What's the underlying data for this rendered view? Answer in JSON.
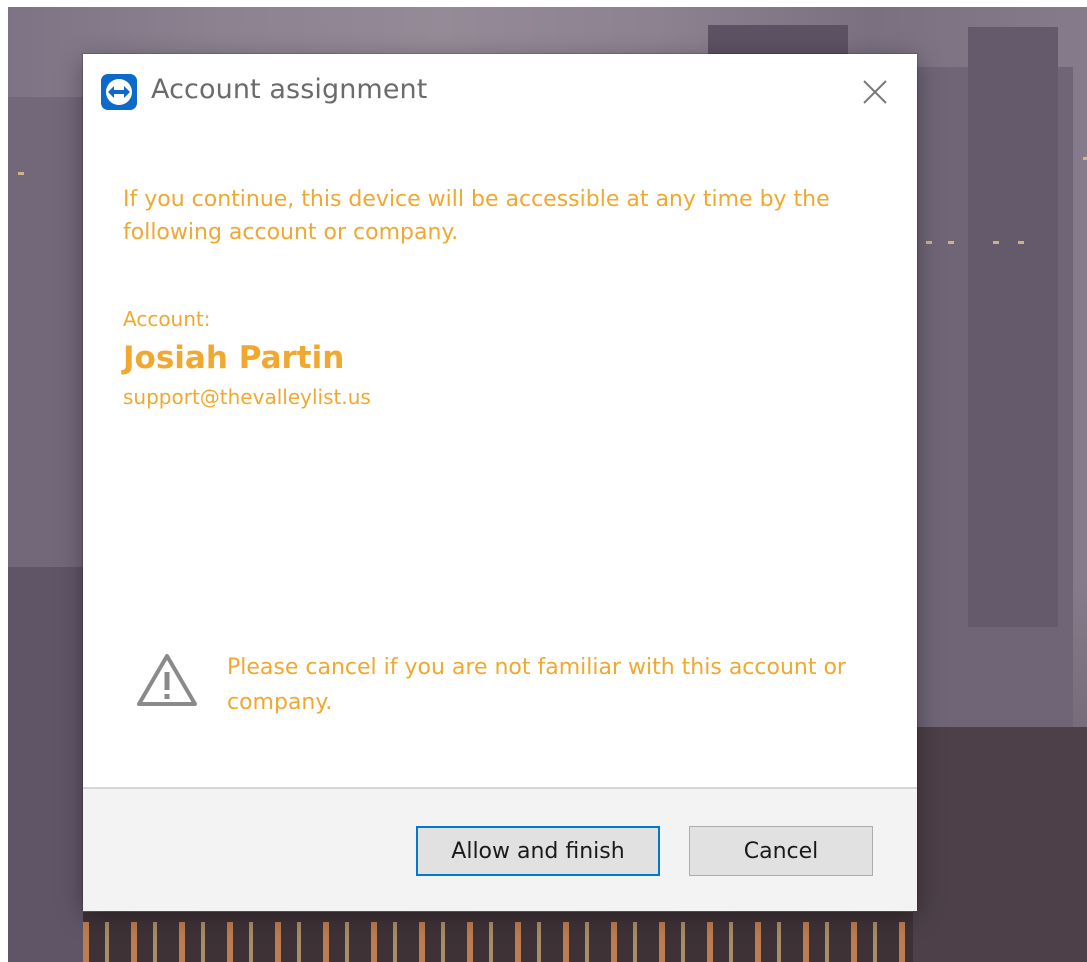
{
  "dialog": {
    "title": "Account assignment",
    "app_icon": "teamviewer-icon",
    "close_icon": "close-icon",
    "intro_text": "If you continue, this device will be accessible at any time by the following account or company.",
    "account_label": "Account:",
    "account_name": "Josiah Partin",
    "account_email": "support@thevalleylist.us",
    "warning_icon": "warning-triangle-icon",
    "warning_text": "Please cancel if you are not familiar with this account or company.",
    "buttons": {
      "allow_label": "Allow and finish",
      "cancel_label": "Cancel"
    }
  },
  "colors": {
    "accent_text": "#f0a830",
    "primary_button_border": "#0078d7",
    "app_icon_blue": "#0e6ac9",
    "title_text": "#6b6b6b"
  }
}
